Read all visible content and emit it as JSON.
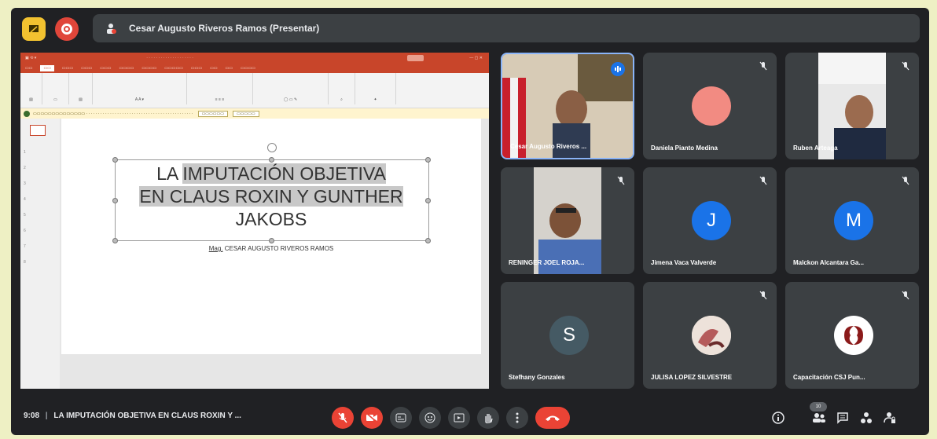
{
  "presenter_bar": {
    "text": "Cesar Augusto Riveros Ramos (Presentar)"
  },
  "slide": {
    "title_line1_plain": "LA ",
    "title_line1_hl": "IMPUTACIÓN OBJETIVA",
    "title_line2_hl": "EN CLAUS ROXIN Y GUNTHER",
    "title_line3": "JAKOBS",
    "subtitle_mag": "Mag.",
    "subtitle_rest": " CESAR AUGUSTO RIVEROS RAMOS"
  },
  "participants": [
    {
      "name": "Cesar Augusto Riveros ...",
      "type": "video"
    },
    {
      "name": "Daniela Pianto Medina",
      "type": "avatar",
      "color": "#f28b82",
      "initial": ""
    },
    {
      "name": "Ruben Arteaga",
      "type": "video"
    },
    {
      "name": "RENINGER JOEL ROJA...",
      "type": "video"
    },
    {
      "name": "Jimena Vaca Valverde",
      "type": "avatar",
      "color": "#1a73e8",
      "initial": "J"
    },
    {
      "name": "Malckon Alcantara Ga...",
      "type": "avatar",
      "color": "#1a73e8",
      "initial": "M"
    },
    {
      "name": "Stefhany Gonzales",
      "type": "avatar",
      "color": "#455a64",
      "initial": "S"
    },
    {
      "name": "JULISA LOPEZ SILVESTRE",
      "type": "photo"
    },
    {
      "name": "Capacitación CSJ Pun...",
      "type": "logo"
    }
  ],
  "bottom": {
    "time": "9:08",
    "separator": "|",
    "meeting_title": "LA IMPUTACIÓN OBJETIVA EN CLAUS ROXIN Y ...",
    "participant_count": "10"
  },
  "colors": {
    "bg": "#202124",
    "tile": "#3c4043",
    "end_call": "#ea4335",
    "outer": "#eef0c4"
  }
}
